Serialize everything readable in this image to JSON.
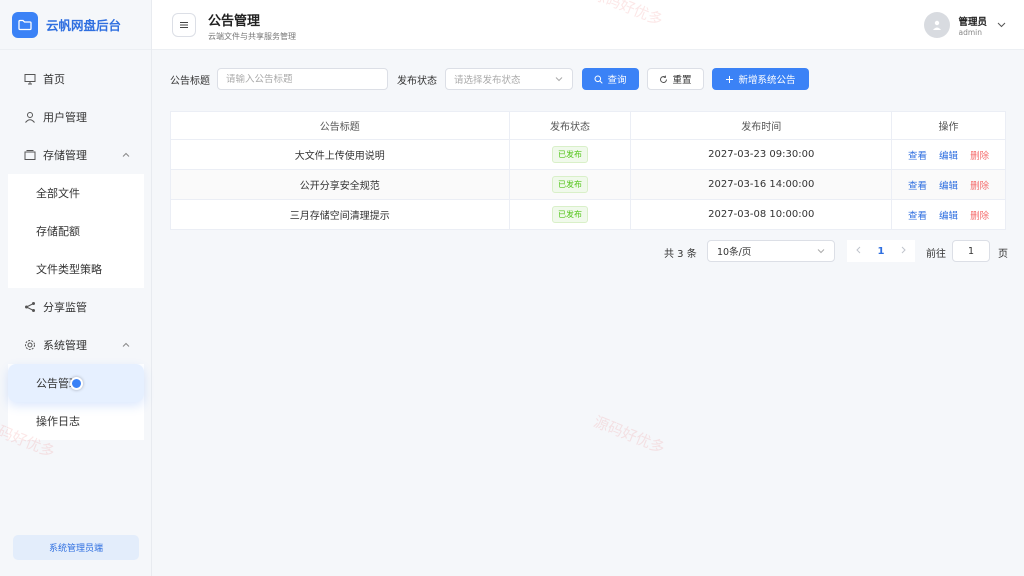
{
  "app": {
    "title": "云帆网盘后台"
  },
  "sidebar": {
    "items": [
      {
        "label": "首页",
        "icon": "monitor-icon"
      },
      {
        "label": "用户管理",
        "icon": "user-icon"
      },
      {
        "label": "存储管理",
        "icon": "storage-icon",
        "expanded": true,
        "children": [
          {
            "label": "全部文件"
          },
          {
            "label": "存储配额"
          },
          {
            "label": "文件类型策略"
          }
        ]
      },
      {
        "label": "分享监管",
        "icon": "share-icon"
      },
      {
        "label": "系统管理",
        "icon": "gear-icon",
        "expanded": true,
        "children": [
          {
            "label": "公告管理",
            "active": true
          },
          {
            "label": "操作日志"
          }
        ]
      }
    ],
    "footer": "系统管理员端"
  },
  "header": {
    "title": "公告管理",
    "subtitle": "云端文件与共享服务管理",
    "user": {
      "name": "管理员",
      "role": "admin"
    }
  },
  "filter": {
    "title_label": "公告标题",
    "title_placeholder": "请输入公告标题",
    "status_label": "发布状态",
    "status_placeholder": "请选择发布状态",
    "search_label": "查询",
    "reset_label": "重置",
    "add_label": "新增系统公告"
  },
  "table": {
    "columns": [
      "公告标题",
      "发布状态",
      "发布时间",
      "操作"
    ],
    "rows": [
      {
        "title": "大文件上传使用说明",
        "status": "已发布",
        "time": "2027-03-23 09:30:00"
      },
      {
        "title": "公开分享安全规范",
        "status": "已发布",
        "time": "2027-03-16 14:00:00"
      },
      {
        "title": "三月存储空间清理提示",
        "status": "已发布",
        "time": "2027-03-08 10:00:00"
      }
    ],
    "actions": {
      "view": "查看",
      "edit": "编辑",
      "delete": "删除"
    }
  },
  "pagination": {
    "total": "共 3 条",
    "page_size": "10条/页",
    "current_page": "1",
    "goto_label": "前往",
    "goto_value": "1",
    "page_unit": "页"
  },
  "watermark": "源码好优多",
  "colors": {
    "primary": "#3b82f6",
    "danger": "#f56c6c",
    "success": "#52c41a"
  }
}
